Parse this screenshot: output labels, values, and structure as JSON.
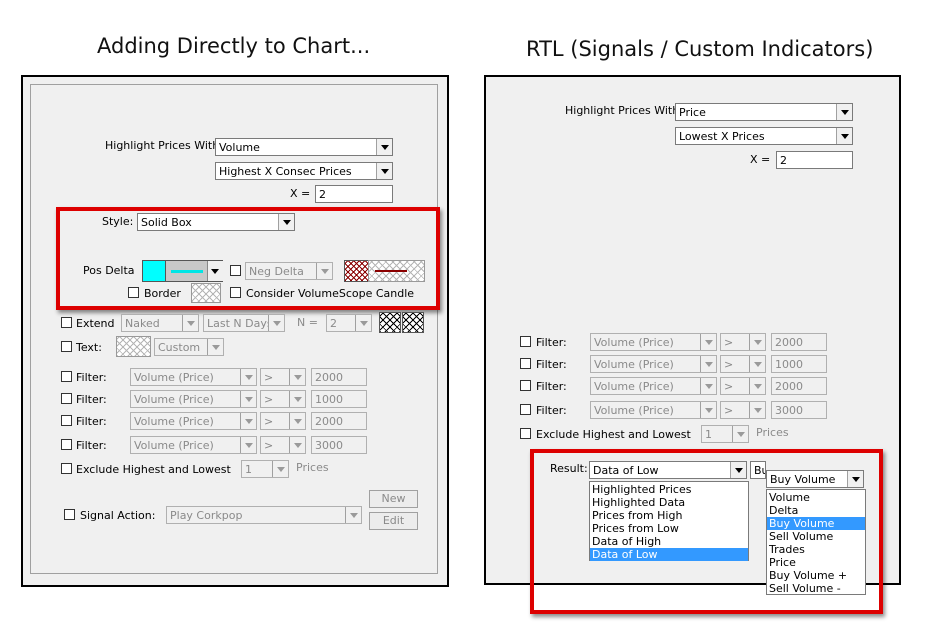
{
  "left": {
    "heading": "Adding Directly to Chart...",
    "highlight_label": "Highlight Prices With:",
    "highlight_value": "Volume",
    "highlight_mode": "Highest X Consec Prices",
    "x_label": "X =",
    "x_value": "2",
    "style_label": "Style:",
    "style_value": "Solid Box",
    "pos_delta_label": "Pos Delta",
    "neg_delta_label": "Neg Delta",
    "border_label": "Border",
    "consider_label": "Consider VolumeScope Candle",
    "extend_label": "Extend",
    "extend_value": "Naked",
    "extend_range": "Last N Days",
    "n_label": "N =",
    "n_value": "2",
    "text_label": "Text:",
    "text_value": "Custom",
    "filters": [
      {
        "label": "Filter:",
        "field": "Volume (Price)",
        "op": ">",
        "value": "2000"
      },
      {
        "label": "Filter:",
        "field": "Volume (Price)",
        "op": ">",
        "value": "1000"
      },
      {
        "label": "Filter:",
        "field": "Volume (Price)",
        "op": ">",
        "value": "2000"
      },
      {
        "label": "Filter:",
        "field": "Volume (Price)",
        "op": ">",
        "value": "3000"
      }
    ],
    "exclude_label": "Exclude Highest and Lowest",
    "exclude_value": "1",
    "prices_label": "Prices",
    "new_button": "New",
    "edit_button": "Edit",
    "signal_label": "Signal Action:",
    "signal_value": "Play Corkpop",
    "colors": {
      "pos_delta": "#00ffff",
      "neg_line": "#8b0000"
    }
  },
  "right": {
    "heading": "RTL (Signals / Custom Indicators)",
    "highlight_label": "Highlight Prices With:",
    "highlight_value": "Price",
    "highlight_mode": "Lowest X Prices",
    "x_label": "X =",
    "x_value": "2",
    "filters": [
      {
        "label": "Filter:",
        "field": "Volume (Price)",
        "op": ">",
        "value": "2000"
      },
      {
        "label": "Filter:",
        "field": "Volume (Price)",
        "op": ">",
        "value": "1000"
      },
      {
        "label": "Filter:",
        "field": "Volume (Price)",
        "op": ">",
        "value": "2000"
      },
      {
        "label": "Filter:",
        "field": "Volume (Price)",
        "op": ">",
        "value": "3000"
      }
    ],
    "exclude_label": "Exclude Highest and Lowest",
    "exclude_value": "1",
    "prices_label": "Prices",
    "result_label": "Result:",
    "result_value": "Data of Low",
    "result_partial": "Bu",
    "result_options": [
      "Highlighted Prices",
      "Highlighted Data",
      "Prices from High",
      "Prices from Low",
      "Data of High",
      "Data of Low"
    ],
    "result_selected_index": 5,
    "data_value": "Buy Volume",
    "data_options": [
      "Volume",
      "Delta",
      "Buy Volume",
      "Sell Volume",
      "Trades",
      "Price",
      "Buy Volume +",
      "Sell Volume -"
    ],
    "data_selected_index": 2
  }
}
